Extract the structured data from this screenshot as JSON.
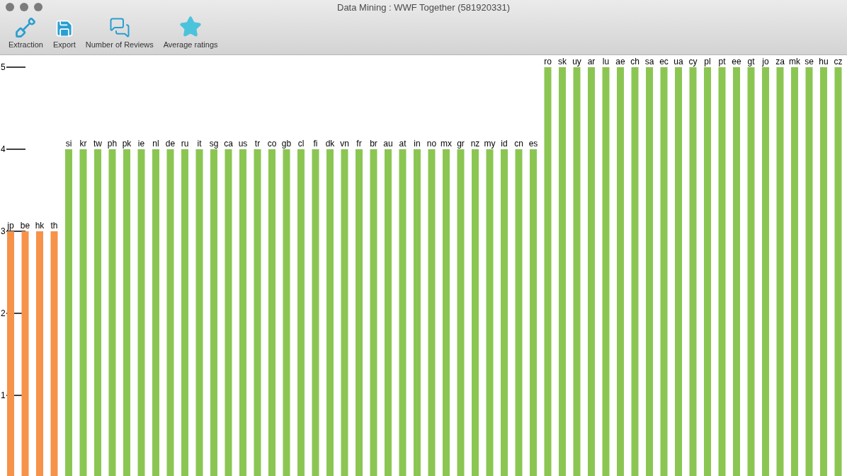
{
  "window": {
    "title": "Data Mining : WWF Together (581920331)"
  },
  "toolbar": [
    {
      "kind": "shovel",
      "label": "Extraction"
    },
    {
      "kind": "save",
      "label": "Export"
    },
    {
      "kind": "chat",
      "label": "Number of Reviews"
    },
    {
      "kind": "star",
      "label": "Average ratings"
    }
  ],
  "chart": {
    "chart_data": {
      "type": "bar",
      "ylim": [
        0,
        5
      ],
      "yticks": [
        1,
        2,
        3,
        4,
        5
      ],
      "categories": [
        "jp",
        "be",
        "hk",
        "th",
        "si",
        "kr",
        "tw",
        "ph",
        "pk",
        "ie",
        "nl",
        "de",
        "ru",
        "it",
        "sg",
        "ca",
        "us",
        "tr",
        "co",
        "gb",
        "cl",
        "fi",
        "dk",
        "vn",
        "fr",
        "br",
        "au",
        "at",
        "in",
        "no",
        "mx",
        "gr",
        "nz",
        "my",
        "id",
        "cn",
        "es",
        "ro",
        "sk",
        "uy",
        "ar",
        "lu",
        "ae",
        "ch",
        "sa",
        "ec",
        "ua",
        "cy",
        "pl",
        "pt",
        "ee",
        "gt",
        "jo",
        "za",
        "mk",
        "se",
        "hu",
        "cz"
      ],
      "series": [
        {
          "color": "#f7924a",
          "values": [
            3,
            3,
            3,
            3,
            null,
            null,
            null,
            null,
            null,
            null,
            null,
            null,
            null,
            null,
            null,
            null,
            null,
            null,
            null,
            null,
            null,
            null,
            null,
            null,
            null,
            null,
            null,
            null,
            null,
            null,
            null,
            null,
            null,
            null,
            null,
            null,
            null,
            null,
            null,
            null,
            null,
            null,
            null,
            null,
            null,
            null,
            null,
            null,
            null,
            null,
            null,
            null,
            null,
            null,
            null,
            null,
            null,
            null
          ]
        },
        {
          "color": "#8bc653",
          "values": [
            null,
            null,
            null,
            null,
            4,
            4,
            4,
            4,
            4,
            4,
            4,
            4,
            4,
            4,
            4,
            4,
            4,
            4,
            4,
            4,
            4,
            4,
            4,
            4,
            4,
            4,
            4,
            4,
            4,
            4,
            4,
            4,
            4,
            4,
            4,
            4,
            4,
            5,
            5,
            5,
            5,
            5,
            5,
            5,
            5,
            5,
            5,
            5,
            5,
            5,
            5,
            5,
            5,
            5,
            5,
            5,
            5,
            5
          ]
        }
      ]
    }
  }
}
